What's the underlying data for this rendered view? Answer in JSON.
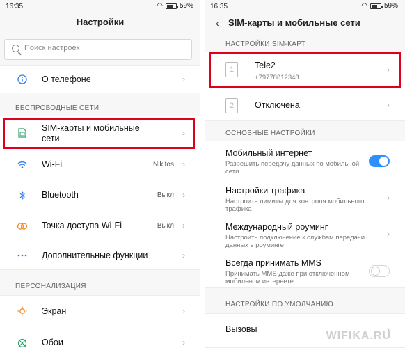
{
  "left": {
    "status": {
      "time": "16:35",
      "battery": "59%"
    },
    "title": "Настройки",
    "search": {
      "placeholder": "Поиск настроек"
    },
    "about": {
      "label": "О телефоне"
    },
    "section_wireless": "БЕСПРОВОДНЫЕ СЕТИ",
    "sim": {
      "label_line1": "SIM-карты и мобильные",
      "label_line2": "сети"
    },
    "wifi": {
      "label": "Wi-Fi",
      "value": "Nikitos"
    },
    "bluetooth": {
      "label": "Bluetooth",
      "value": "Выкл"
    },
    "hotspot": {
      "label": "Точка доступа Wi-Fi",
      "value": "Выкл"
    },
    "extra": {
      "label": "Дополнительные функции"
    },
    "section_personal": "ПЕРСОНАЛИЗАЦИЯ",
    "screen": {
      "label": "Экран"
    },
    "wallpaper": {
      "label": "Обои"
    }
  },
  "right": {
    "status": {
      "time": "16:35",
      "battery": "59%"
    },
    "title": "SIM-карты и мобильные сети",
    "section_sim": "НАСТРОЙКИ SIM-КАРТ",
    "sim1": {
      "slot": "1",
      "name": "Tele2",
      "number": "+79778812348"
    },
    "sim2": {
      "slot": "2",
      "name": "Отключена"
    },
    "section_basic": "ОСНОВНЫЕ НАСТРОЙКИ",
    "mobile_internet": {
      "label": "Мобильный интернет",
      "sub": "Разрешить передачу данных по мобильной сети",
      "enabled": true
    },
    "traffic": {
      "label": "Настройки трафика",
      "sub": "Настроить лимиты для контроля мобильного трафика"
    },
    "roaming": {
      "label": "Международный роуминг",
      "sub": "Настроить подключение к службам передачи данных в роуминге"
    },
    "mms": {
      "label": "Всегда принимать MMS",
      "sub": "Принимать MMS даже при отключенном мобильном интернете",
      "enabled": false
    },
    "section_default": "НАСТРОЙКИ ПО УМОЛЧАНИЮ",
    "calls": {
      "label": "Вызовы"
    }
  },
  "watermark": "WIFIKA.RU",
  "colors": {
    "highlight": "#e0001b",
    "toggle_on": "#2e8fff"
  }
}
